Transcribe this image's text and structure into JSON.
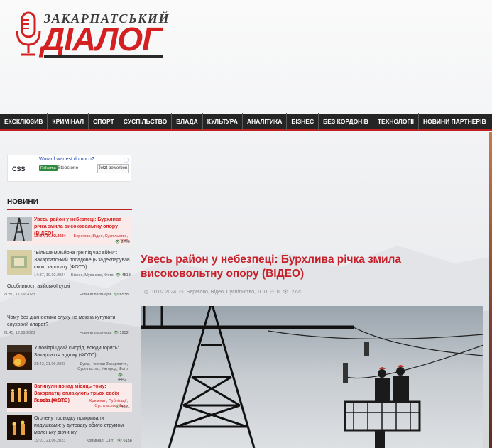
{
  "logo": {
    "top": "ЗАКАРПАТСЬКИЙ",
    "main": "ДІАЛОГ"
  },
  "nav": [
    "ЕКСКЛЮЗИВ",
    "КРИМІНАЛ",
    "СПОРТ",
    "СУСПІЛЬСТВО",
    "ВЛАДА",
    "КУЛЬТУРА",
    "АНАЛІТИКА",
    "БІЗНЕС",
    "БЕЗ КОРДОНІВ",
    "ТЕХНОЛОГІЇ",
    "НОВИНИ ПАРТНЕРІВ"
  ],
  "ad": {
    "logo": "CSS",
    "title": "Worauf wartest du noch?",
    "badge": "Reklama",
    "brand": "Stepstone",
    "cta": "Jetzt bewerben",
    "info_icon": "info-icon"
  },
  "sidebar": {
    "heading": "НОВИНИ",
    "items": [
      {
        "title": "Увесь район у небезпеці: Бурхлива річка змила високовольтну опору (ВІДЕО)",
        "time": "18:27, 10.02.2024",
        "cats": "Берегово, Відео, Суспільство, ТОП",
        "views": "2726"
      },
      {
        "title": "\"Більше мільйона грн під час війни\": Закарпатський посадовець задекларував свою зарплату (ФОТО)",
        "time": "14:37, 10.02.2024",
        "cats": "Бізнес, Мукачево, Фото",
        "views": "4513"
      },
      {
        "title": "Особливості азійської кухні",
        "time": "21:50, 17.09.2023",
        "cats": "Новини партнерів",
        "views": "6538"
      },
      {
        "title": "Чому без діагностики слуху не можна купувати слуховий апарат?",
        "time": "21:45, 17.09.2023",
        "cats": "Новини партнерів",
        "views": "1952"
      },
      {
        "title": "У повітрі їдкий сморід, всюди горить: Закарпаття в диму (ФОТО)",
        "time": "21:43, 21.06.2023",
        "cats": "Дума, Новини Закарпаття, Суспільство, Ужгород, Фото",
        "views": "4442"
      },
      {
        "title": "Загинули понад місяць тому: Закарпатці оплакують трьох своїх Героїв (ФОТО)",
        "time": "20:18, 21.06.2023",
        "cats": "Кримінал, Публікації, Суспільство, Фото",
        "views": "4321"
      },
      {
        "title": "Оголену проводку прикривали подушками: у дитсадку вбило струмом маленьку дівчинку",
        "time": "19:01, 21.06.2023",
        "cats": "Кримінал, Світ",
        "views": "6158"
      }
    ]
  },
  "article": {
    "title": "Увесь район у небезпеці: Бурхлива річка змила високовольтну опору (ВІДЕО)",
    "date": "10.02.2024",
    "cats": "Берегово, Відео, Суспільство, ТОП",
    "comments": "0",
    "views": "2720"
  },
  "colors": {
    "accent": "#c21f1f",
    "nav_bg": "#252525",
    "title_red": "#c6202a"
  }
}
